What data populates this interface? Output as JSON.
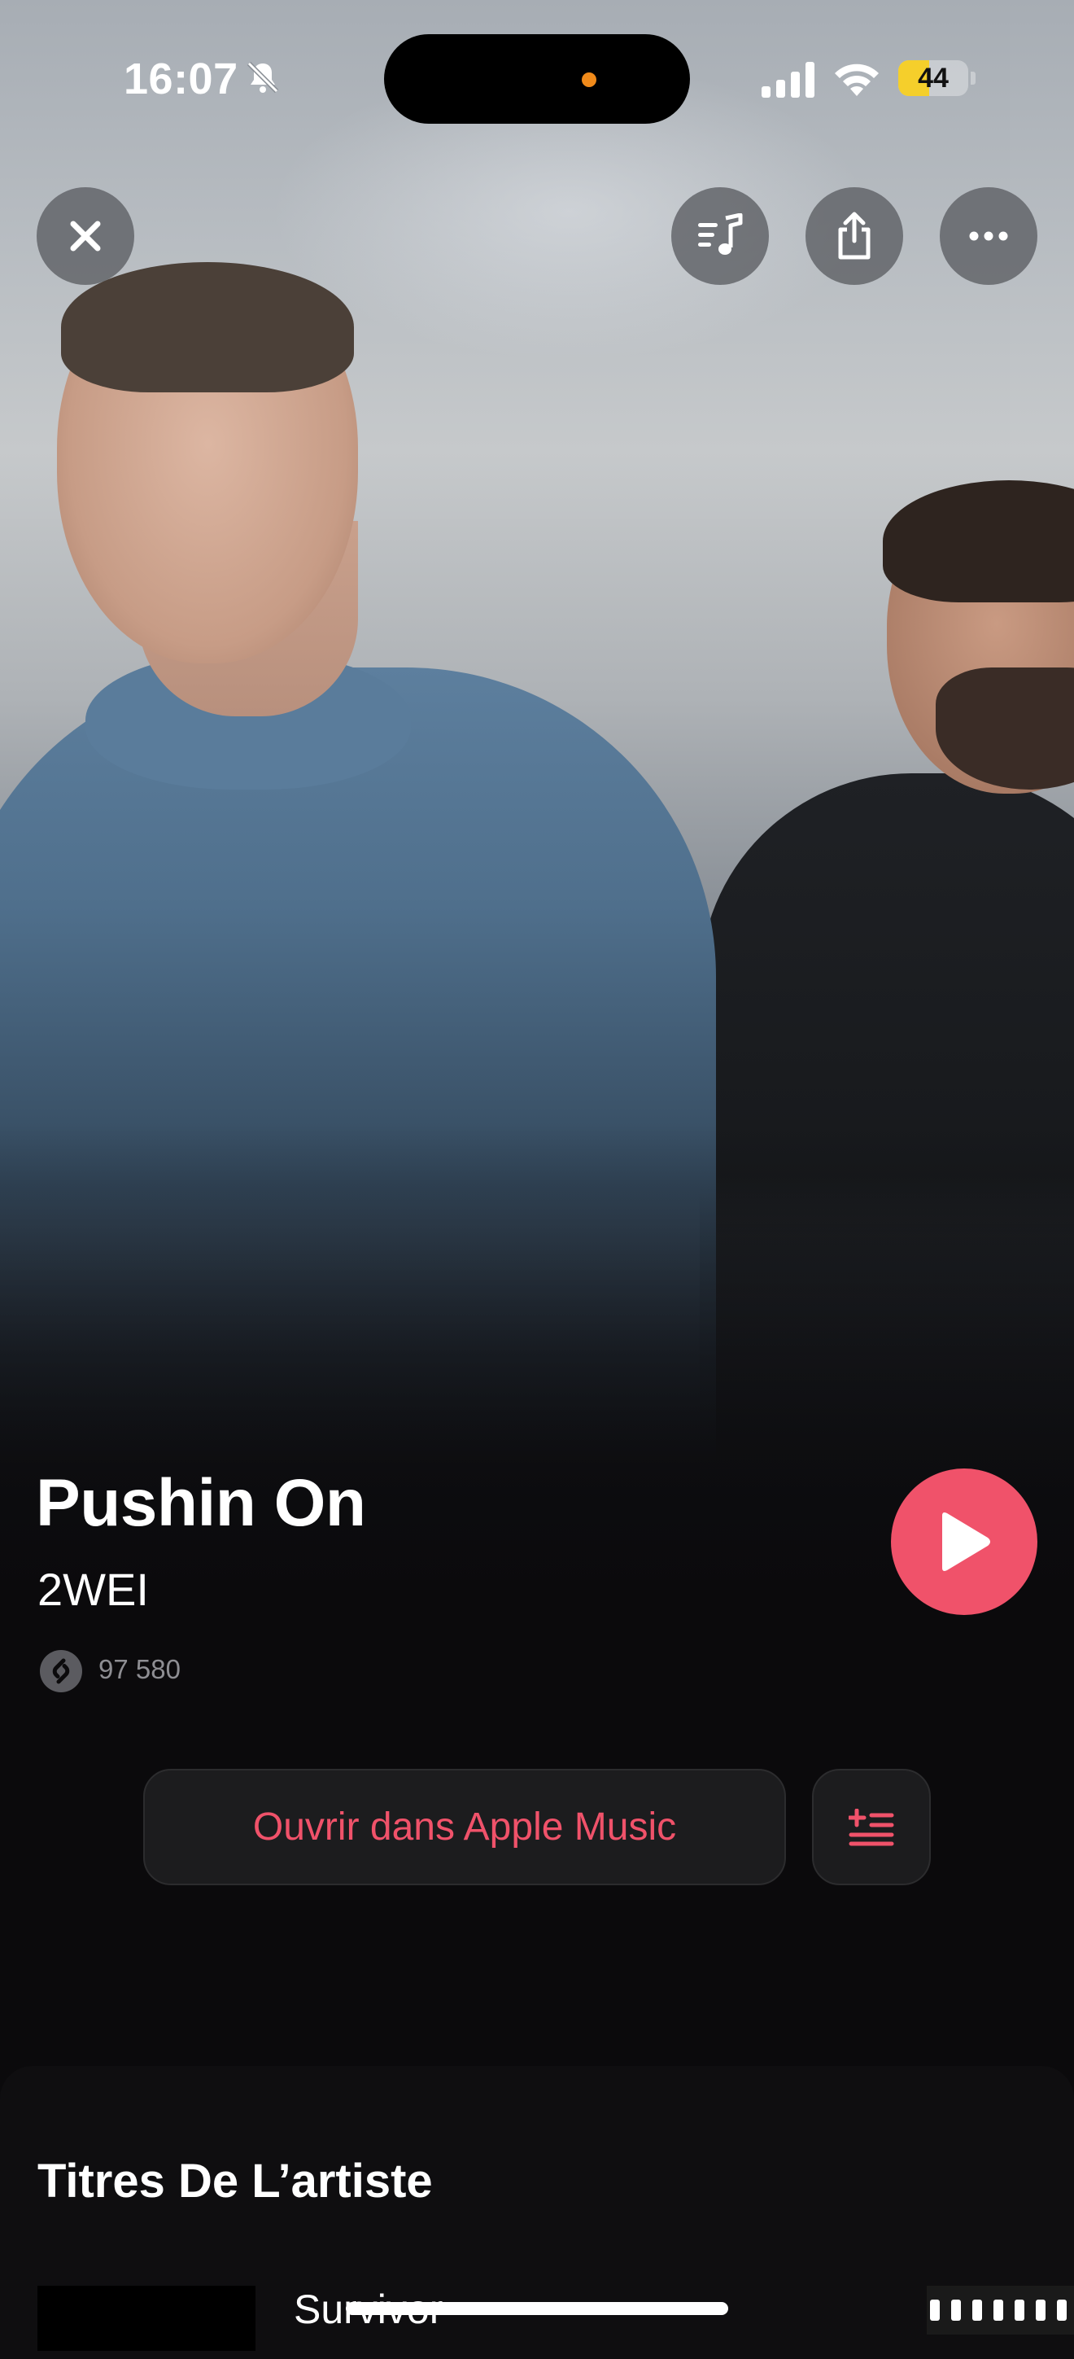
{
  "status_bar": {
    "time": "16:07",
    "silent_icon": "bell-slash-icon",
    "signal_icon": "cellular-signal-icon",
    "wifi_icon": "wifi-icon",
    "battery_level": "44",
    "battery_fraction": 0.44,
    "battery_color": "#f5cf2b",
    "island_indicator_color": "#f08a1a"
  },
  "top_bar": {
    "close_icon": "close-icon",
    "lyrics_icon": "music-list-icon",
    "share_icon": "share-icon",
    "more_icon": "ellipsis-icon"
  },
  "song": {
    "title": "Pushin On",
    "artist": "2WEI",
    "shazam_count": "97 580",
    "shazam_icon": "shazam-icon",
    "play_icon": "play-icon"
  },
  "actions": {
    "open_label": "Ouvrir dans Apple Music",
    "queue_icon": "add-to-queue-icon"
  },
  "artist_tracks": {
    "heading": "Titres De L’artiste",
    "items": [
      {
        "title": "Survivor"
      }
    ]
  },
  "colors": {
    "accent": "#f0526a",
    "background": "#0b0a0c",
    "button_bg": "#1c1c1e"
  }
}
